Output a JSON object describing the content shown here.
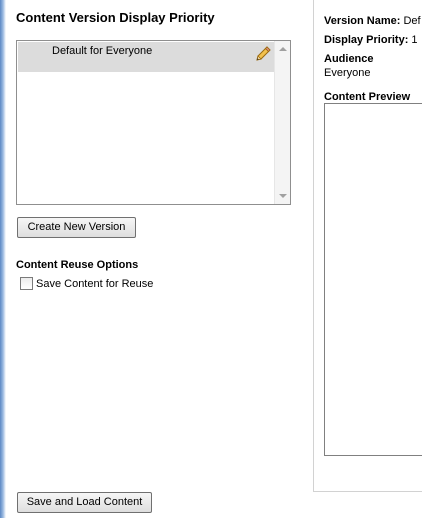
{
  "left": {
    "title": "Content Version Display Priority",
    "versions": [
      {
        "label": "Default for Everyone",
        "selected": true
      }
    ],
    "create_button": "Create New Version",
    "reuse_title": "Content Reuse Options",
    "reuse_checkbox_label": "Save Content for Reuse",
    "reuse_checked": false,
    "save_button": "Save and Load Content"
  },
  "right": {
    "version_name_label": "Version Name:",
    "version_name_value": "Def",
    "display_priority_label": "Display Priority:",
    "display_priority_value": "1",
    "audience_label": "Audience",
    "audience_value": "Everyone",
    "preview_label": "Content Preview"
  },
  "icons": {
    "edit": "pencil-icon",
    "scroll_up": "scroll-up-arrow-icon",
    "scroll_down": "scroll-down-arrow-icon"
  },
  "colors": {
    "selected_row": "#dcdcdc",
    "left_edge_accent": "#5b88c4"
  }
}
